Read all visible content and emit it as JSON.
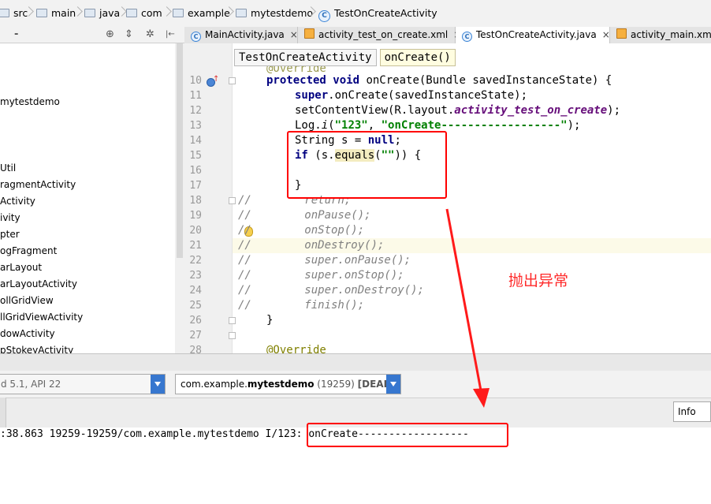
{
  "breadcrumb": {
    "items": [
      {
        "label": "src",
        "icon": "folder-icon"
      },
      {
        "label": "main",
        "icon": "folder-icon"
      },
      {
        "label": "java",
        "icon": "folder-icon"
      },
      {
        "label": "com",
        "icon": "folder-icon"
      },
      {
        "label": "example",
        "icon": "folder-icon"
      },
      {
        "label": "mytestdemo",
        "icon": "folder-icon"
      },
      {
        "label": "TestOnCreateActivity",
        "icon": "class-icon"
      }
    ]
  },
  "project_tools": {
    "collapse_label": "-",
    "target_icon": "⊕",
    "split_icon": "⇕",
    "gear_icon": "✲",
    "hide_icon": "|←"
  },
  "tabs": [
    {
      "label": "MainActivity.java",
      "icon": "class-icon",
      "active": false
    },
    {
      "label": "activity_test_on_create.xml",
      "icon": "xml-icon",
      "active": false
    },
    {
      "label": "TestOnCreateActivity.java",
      "icon": "class-icon",
      "active": true
    },
    {
      "label": "activity_main.xml",
      "icon": "xml-icon",
      "active": false
    }
  ],
  "tab_close": "×",
  "project_tree": [
    "mytestdemo",
    "Util",
    "ragmentActivity",
    "Activity",
    "ivity",
    "pter",
    "ogFragment",
    "arLayout",
    "arLayoutActivity",
    "ollGridView",
    "llGridViewActivity",
    "dowActivity",
    "pStokeyActivity"
  ],
  "editor": {
    "breadcrumb_class": "TestOnCreateActivity",
    "breadcrumb_method": "onCreate()",
    "top_partial": "@Override",
    "line_numbers": [
      "10",
      "11",
      "12",
      "13",
      "14",
      "15",
      "16",
      "17",
      "18",
      "19",
      "20",
      "21",
      "22",
      "23",
      "24",
      "25",
      "26",
      "27",
      "28"
    ],
    "code": {
      "l10_kw1": "protected",
      "l10_kw2": "void",
      "l10_rest": "onCreate(Bundle savedInstanceState) {",
      "l11_kw": "super",
      "l11_rest": ".onCreate(savedInstanceState);",
      "l12_a": "setContentView(R.layout.",
      "l12_b": "activity_test_on_create",
      "l12_c": ");",
      "l13_a": "Log.",
      "l13_b": "i",
      "l13_c": "(",
      "l13_s1": "\"123\"",
      "l13_d": ", ",
      "l13_s2": "\"onCreate------------------\"",
      "l13_e": ");",
      "l14_a": "String s = ",
      "l14_kw": "null",
      "l14_b": ";",
      "l15_kw": "if",
      "l15_a": " (s.",
      "l15_b": "equals",
      "l15_c": "(",
      "l15_s": "\"\"",
      "l15_d": ")) {",
      "l17": "}",
      "l18": "//        return;",
      "l19": "//        onPause();",
      "l20": "//        onStop();",
      "l21": "//        onDestroy();",
      "l22": "//        super.onPause();",
      "l23": "//        super.onStop();",
      "l24": "//        super.onDestroy();",
      "l25": "//        finish();",
      "l26": "}",
      "l28": "@Override"
    }
  },
  "annotation": {
    "text": "抛出异常",
    "color": "#ff2a2a"
  },
  "logcat": {
    "device_combo": "d 5.1, API 22",
    "process_prefix": "com.example.",
    "process_bold": "mytestdemo",
    "process_pid": " (19259) ",
    "process_state": "[DEAD]",
    "level": "Info",
    "line_prefix": ":38.863 19259-19259/com.example.mytestdemo I/123: ",
    "line_msg": "onCreate------------------"
  },
  "colors": {
    "accent": "#3777cf",
    "highlight_box": "#ff0000",
    "keyword": "#000080",
    "string": "#008000"
  }
}
